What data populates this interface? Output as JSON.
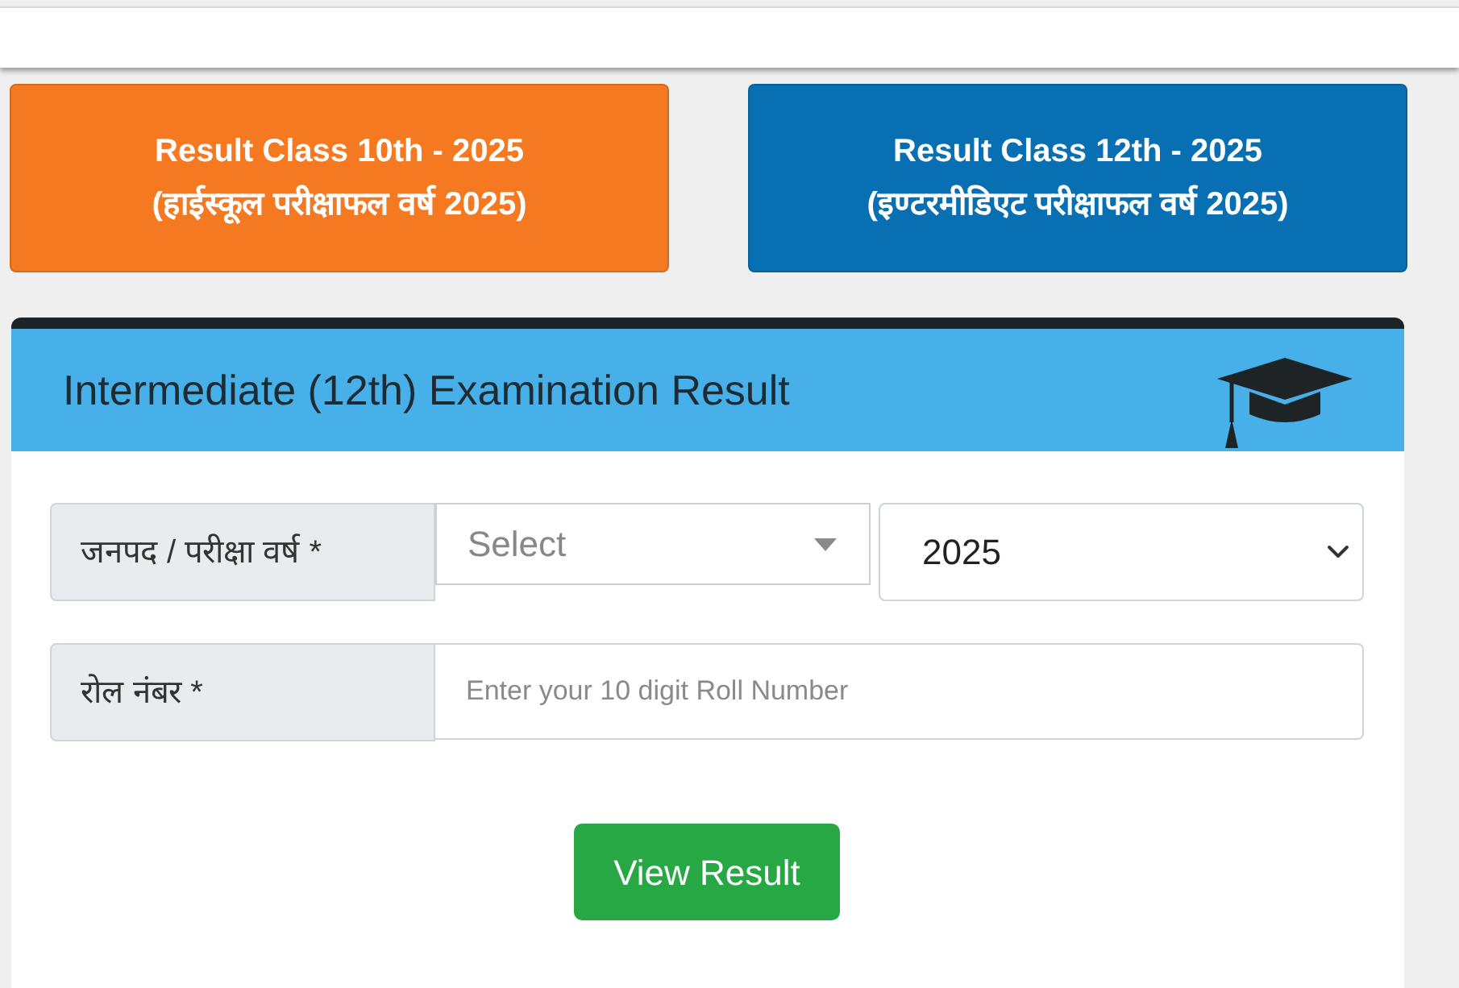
{
  "result_buttons": [
    {
      "line_1": "Result Class 10th - 2025",
      "line_2": "(हाईस्कूल परीक्षाफल वर्ष 2025)",
      "color": "#f47920"
    },
    {
      "line_1": "Result Class 12th - 2025",
      "line_2": "(इण्टरमीडिएट परीक्षाफल वर्ष 2025)",
      "color": "#0870b2"
    }
  ],
  "card": {
    "title": "Intermediate (12th) Examination Result"
  },
  "form_rows": [
    {
      "label": "जनपद / परीक्षा वर्ष *",
      "fields": [
        {
          "kind": "dropdown",
          "placeholder": "Select"
        },
        {
          "kind": "select",
          "value": "2025"
        }
      ]
    },
    {
      "label": "रोल नंबर *",
      "fields": [
        {
          "kind": "text",
          "placeholder": "Enter your 10 digit Roll Number"
        }
      ]
    }
  ],
  "submit_button": {
    "label": "View Result"
  }
}
